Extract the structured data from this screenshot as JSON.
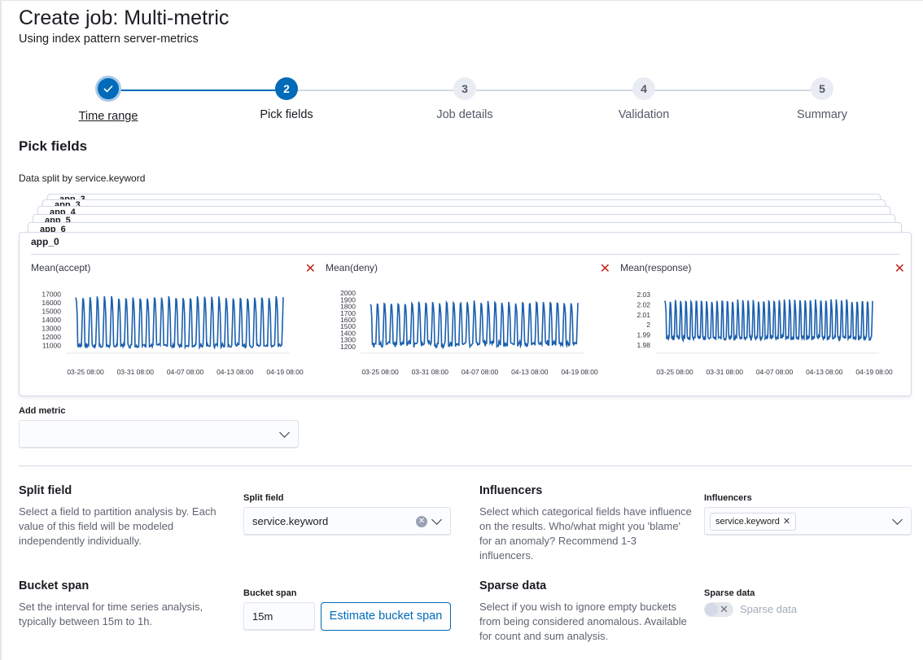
{
  "header": {
    "title": "Create job: Multi-metric",
    "subtitle": "Using index pattern server-metrics"
  },
  "steps": [
    {
      "number": "✓",
      "label": "Time range",
      "state": "done"
    },
    {
      "number": "2",
      "label": "Pick fields",
      "state": "current"
    },
    {
      "number": "3",
      "label": "Job details",
      "state": "todo"
    },
    {
      "number": "4",
      "label": "Validation",
      "state": "todo"
    },
    {
      "number": "5",
      "label": "Summary",
      "state": "todo"
    }
  ],
  "pick_fields": {
    "heading": "Pick fields",
    "split_note": "Data split by service.keyword",
    "stacked_cards": [
      "app_3",
      "app_4",
      "app_5",
      "app_6"
    ],
    "main_card_title": "app_0"
  },
  "chart_data": [
    {
      "type": "line",
      "title": "Mean(accept)",
      "x_ticks": [
        "03-25 08:00",
        "03-31 08:00",
        "04-07 08:00",
        "04-13 08:00",
        "04-19 08:00"
      ],
      "y_ticks": [
        "17000",
        "16000",
        "15000",
        "14000",
        "13000",
        "12000",
        "11000"
      ],
      "ylim": [
        10500,
        17500
      ],
      "pattern": {
        "cycles": 29,
        "low": 11000,
        "high": 16600,
        "jitter": 300
      }
    },
    {
      "type": "line",
      "title": "Mean(deny)",
      "x_ticks": [
        "03-25 08:00",
        "03-31 08:00",
        "04-07 08:00",
        "04-13 08:00",
        "04-19 08:00"
      ],
      "y_ticks": [
        "2000",
        "1900",
        "1800",
        "1700",
        "1600",
        "1500",
        "1400",
        "1300",
        "1200"
      ],
      "ylim": [
        1150,
        2050
      ],
      "pattern": {
        "cycles": 30,
        "low": 1240,
        "high": 1860,
        "jitter": 60
      }
    },
    {
      "type": "line",
      "title": "Mean(response)",
      "x_ticks": [
        "03-25 08:00",
        "03-31 08:00",
        "04-07 08:00",
        "04-13 08:00",
        "04-19 08:00"
      ],
      "y_ticks": [
        "2.03",
        "2.02",
        "2.01",
        "2",
        "1.99",
        "1.98"
      ],
      "ylim": [
        1.975,
        2.035
      ],
      "pattern": {
        "cycles": 40,
        "low": 1.987,
        "high": 2.024,
        "jitter": 0.003
      }
    }
  ],
  "add_metric": {
    "label": "Add metric",
    "value": ""
  },
  "split_field": {
    "title": "Split field",
    "description": "Select a field to partition analysis by. Each value of this field will be modeled independently individually.",
    "label": "Split field",
    "value": "service.keyword"
  },
  "influencers": {
    "title": "Influencers",
    "description": "Select which categorical fields have influence on the results. Who/what might you 'blame' for an anomaly? Recommend 1-3 influencers.",
    "label": "Influencers",
    "pill": "service.keyword"
  },
  "bucket_span": {
    "title": "Bucket span",
    "description": "Set the interval for time series analysis, typically between 15m to 1h.",
    "label": "Bucket span",
    "value": "15m",
    "button": "Estimate bucket span"
  },
  "sparse_data": {
    "title": "Sparse data",
    "description": "Select if you wish to ignore empty buckets from being considered anomalous. Available for count and sum analysis.",
    "label": "Sparse data",
    "toggle_label": "Sparse data",
    "enabled": false
  },
  "colors": {
    "accent": "#006bb8",
    "danger": "#bd271e",
    "line": "#1a5fad"
  }
}
